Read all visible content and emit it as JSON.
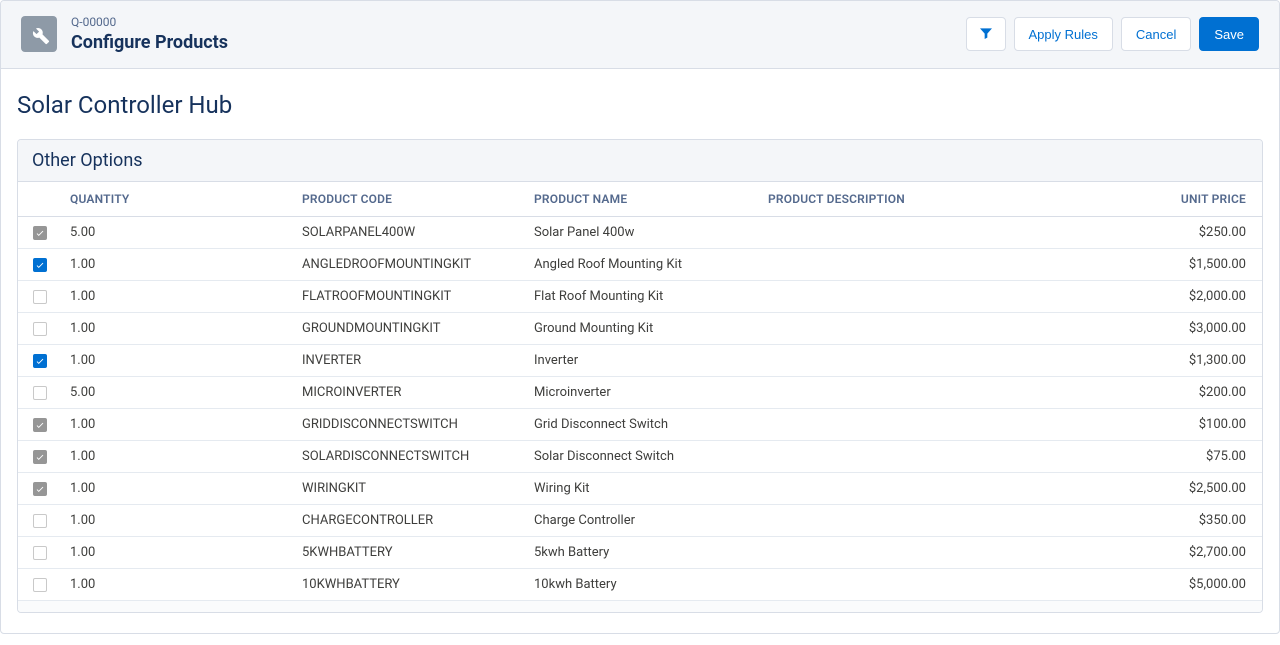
{
  "header": {
    "quoteId": "Q-00000",
    "pageTitle": "Configure Products",
    "actions": {
      "applyRules": "Apply Rules",
      "cancel": "Cancel",
      "save": "Save"
    }
  },
  "sectionTitle": "Solar Controller Hub",
  "panel": {
    "title": "Other Options",
    "columns": {
      "quantity": "QUANTITY",
      "productCode": "PRODUCT CODE",
      "productName": "PRODUCT NAME",
      "productDescription": "PRODUCT DESCRIPTION",
      "unitPrice": "UNIT PRICE"
    },
    "rows": [
      {
        "checked": true,
        "disabled": true,
        "quantity": "5.00",
        "code": "SOLARPANEL400W",
        "name": "Solar Panel 400w",
        "description": "",
        "price": "$250.00"
      },
      {
        "checked": true,
        "disabled": false,
        "quantity": "1.00",
        "code": "ANGLEDROOFMOUNTINGKIT",
        "name": "Angled Roof Mounting Kit",
        "description": "",
        "price": "$1,500.00"
      },
      {
        "checked": false,
        "disabled": false,
        "quantity": "1.00",
        "code": "FLATROOFMOUNTINGKIT",
        "name": "Flat Roof Mounting Kit",
        "description": "",
        "price": "$2,000.00"
      },
      {
        "checked": false,
        "disabled": false,
        "quantity": "1.00",
        "code": "GROUNDMOUNTINGKIT",
        "name": "Ground Mounting Kit",
        "description": "",
        "price": "$3,000.00"
      },
      {
        "checked": true,
        "disabled": false,
        "quantity": "1.00",
        "code": "INVERTER",
        "name": "Inverter",
        "description": "",
        "price": "$1,300.00"
      },
      {
        "checked": false,
        "disabled": false,
        "quantity": "5.00",
        "code": "MICROINVERTER",
        "name": "Microinverter",
        "description": "",
        "price": "$200.00"
      },
      {
        "checked": true,
        "disabled": true,
        "quantity": "1.00",
        "code": "GRIDDISCONNECTSWITCH",
        "name": "Grid Disconnect Switch",
        "description": "",
        "price": "$100.00"
      },
      {
        "checked": true,
        "disabled": true,
        "quantity": "1.00",
        "code": "SOLARDISCONNECTSWITCH",
        "name": "Solar Disconnect Switch",
        "description": "",
        "price": "$75.00"
      },
      {
        "checked": true,
        "disabled": true,
        "quantity": "1.00",
        "code": "WIRINGKIT",
        "name": "Wiring Kit",
        "description": "",
        "price": "$2,500.00"
      },
      {
        "checked": false,
        "disabled": false,
        "quantity": "1.00",
        "code": "CHARGECONTROLLER",
        "name": "Charge Controller",
        "description": "",
        "price": "$350.00"
      },
      {
        "checked": false,
        "disabled": false,
        "quantity": "1.00",
        "code": "5KWHBATTERY",
        "name": "5kwh Battery",
        "description": "",
        "price": "$2,700.00"
      },
      {
        "checked": false,
        "disabled": false,
        "quantity": "1.00",
        "code": "10KWHBATTERY",
        "name": "10kwh Battery",
        "description": "",
        "price": "$5,000.00"
      }
    ]
  }
}
